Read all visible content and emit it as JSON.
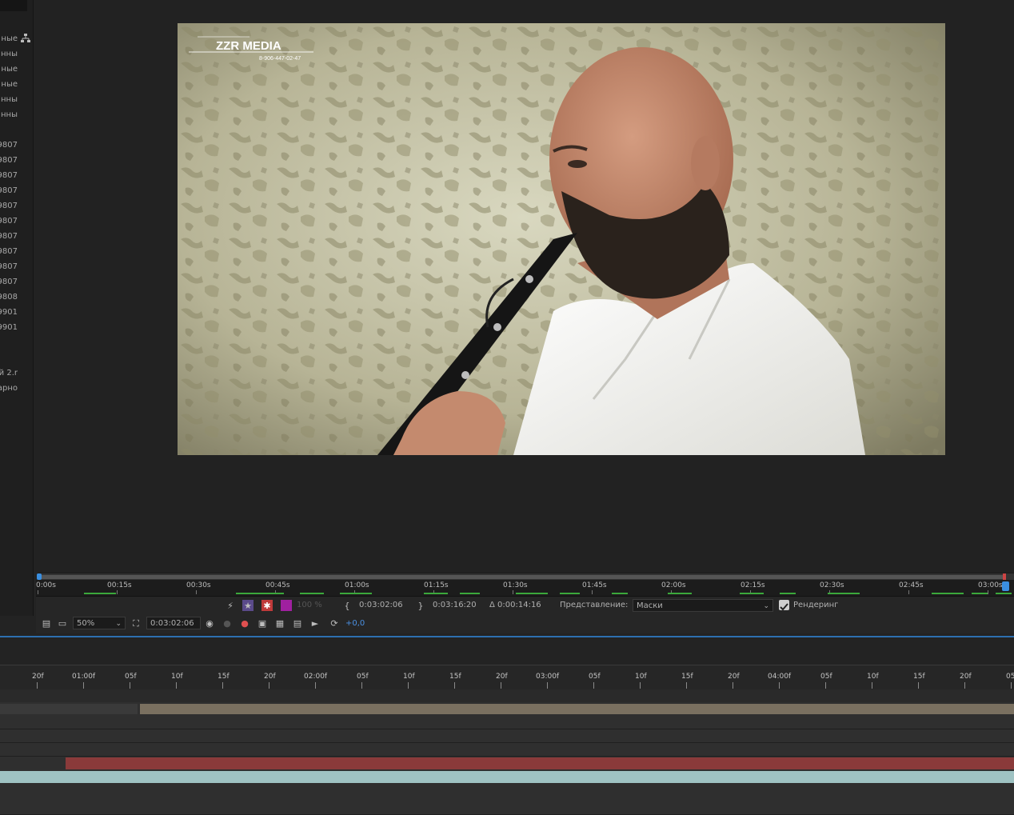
{
  "project_panel": {
    "items": [
      "ные",
      "нны",
      "ные",
      "ные",
      "нны",
      "нны",
      "9807",
      "9807",
      "9807",
      "9807",
      "9807",
      "9807",
      "9807",
      "9807",
      "9807",
      "9807",
      "9808",
      "9901",
      "9901",
      "ий 2.r",
      "арно"
    ]
  },
  "viewer": {
    "watermark_title": "ZZR MEDIA",
    "watermark_phone": "8-906-447-02-47"
  },
  "mini_timeline": {
    "ticks": [
      "0:00s",
      "00:15s",
      "00:30s",
      "00:45s",
      "01:00s",
      "01:15s",
      "01:30s",
      "01:45s",
      "02:00s",
      "02:15s",
      "02:30s",
      "02:45s",
      "03:00s"
    ]
  },
  "toolbar1": {
    "opacity_label": "100 %",
    "in_point": "0:03:02:06",
    "out_point": "0:03:16:20",
    "duration": "Δ 0:00:14:16",
    "view_label": "Представление:",
    "view_value": "Маски",
    "render_label": "Рендеринг"
  },
  "toolbar2": {
    "zoom": "50%",
    "timecode": "0:03:02:06",
    "exposure": "+0,0"
  },
  "timeline": {
    "ticks": [
      "20f",
      "01:00f",
      "05f",
      "10f",
      "15f",
      "20f",
      "02:00f",
      "05f",
      "10f",
      "15f",
      "20f",
      "03:00f",
      "05f",
      "10f",
      "15f",
      "20f",
      "04:00f",
      "05f",
      "10f",
      "15f",
      "20f",
      "05f"
    ]
  },
  "colors": {
    "accent_blue": "#2d6fb0",
    "clip_tan": "#7a7060",
    "clip_red": "#8a3a3a",
    "clip_teal": "#9fc3c3",
    "render_green": "#3ba83b"
  }
}
